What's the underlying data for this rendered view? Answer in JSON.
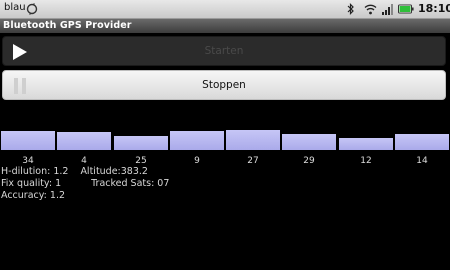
{
  "status_bar": {
    "carrier": "blau",
    "time": "18:10",
    "icons": [
      "sync-icon",
      "bluetooth-icon",
      "wifi-icon",
      "signal-icon",
      "battery-icon"
    ],
    "battery_color": "#2fbf3a"
  },
  "app": {
    "title": "Bluetooth GPS Provider"
  },
  "buttons": {
    "start_label": "Starten",
    "stop_label": "Stoppen"
  },
  "satellites": {
    "bar_color": "#b7b7f2",
    "items": [
      {
        "id": "34",
        "level": 0.95
      },
      {
        "id": "4",
        "level": 0.88
      },
      {
        "id": "25",
        "level": 0.68
      },
      {
        "id": "9",
        "level": 0.95
      },
      {
        "id": "27",
        "level": 1.0
      },
      {
        "id": "29",
        "level": 0.82
      },
      {
        "id": "12",
        "level": 0.62
      },
      {
        "id": "14",
        "level": 0.8
      }
    ]
  },
  "info": {
    "hdop": "H-dilution: 1.2",
    "altitude": "Altitude:383.2",
    "fix_quality": "Fix quality: 1",
    "tracked_sats": "Tracked Sats: 07",
    "accuracy": "Accuracy: 1.2"
  }
}
